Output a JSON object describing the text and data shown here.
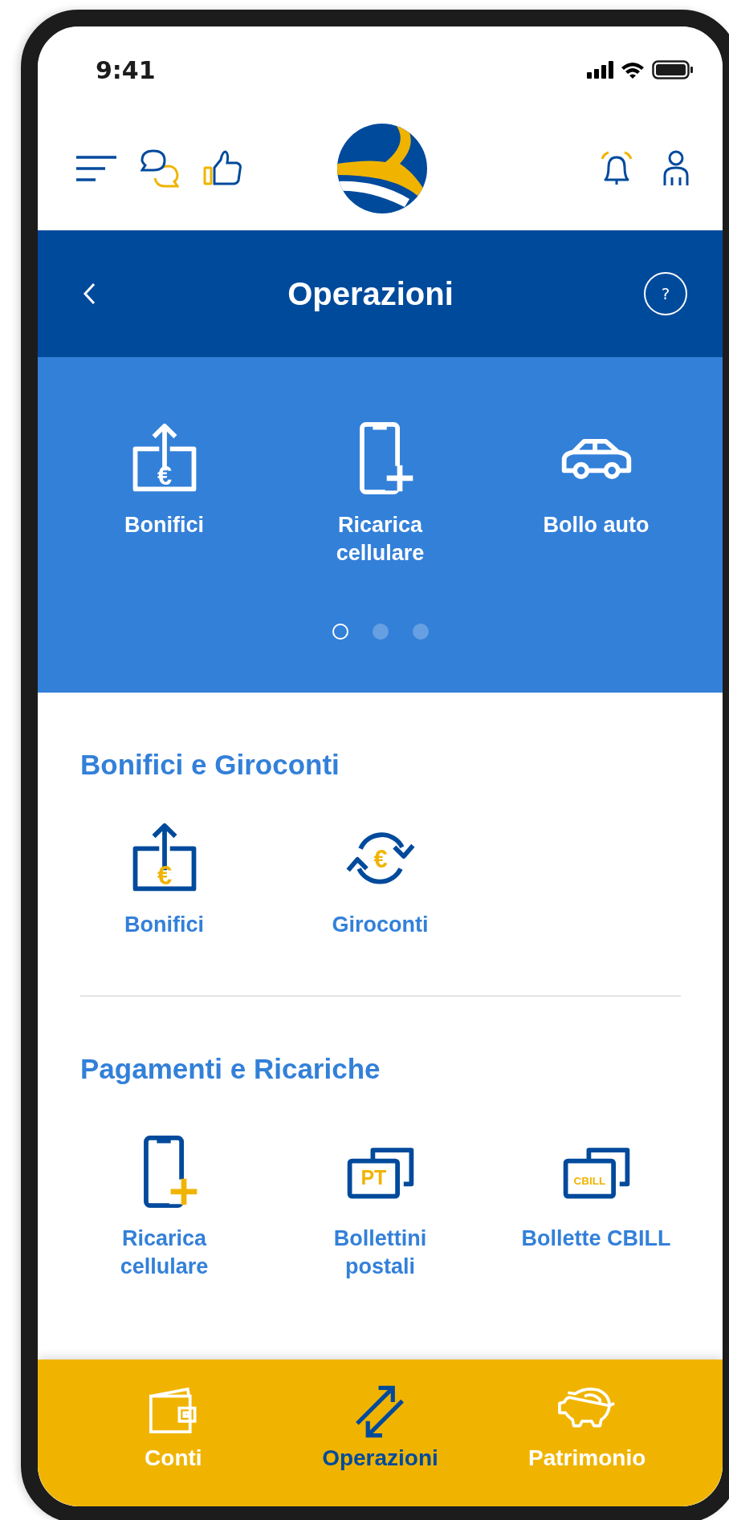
{
  "status_bar": {
    "time": "9:41"
  },
  "title_bar": {
    "title": "Operazioni",
    "help": "?"
  },
  "carousel": {
    "items": [
      {
        "label": "Bonifici",
        "kind": "transfer",
        "symbol": "€"
      },
      {
        "label": "Ricarica cellulare",
        "kind": "phone"
      },
      {
        "label": "Bollo auto",
        "kind": "car"
      }
    ],
    "pages": [
      {
        "selected": true
      },
      {
        "selected": false
      },
      {
        "selected": false
      }
    ]
  },
  "sections": [
    {
      "title": "Bonifici e Giroconti",
      "items": [
        {
          "label": "Bonifici",
          "kind": "transfer",
          "symbol": "€"
        },
        {
          "label": "Giroconti",
          "kind": "exchange",
          "symbol": "€"
        }
      ]
    },
    {
      "title": "Pagamenti e Ricariche",
      "items": [
        {
          "label": "Ricarica cellulare",
          "kind": "phone"
        },
        {
          "label": "Bollettini postali",
          "kind": "bills",
          "symbol": "PT"
        },
        {
          "label": "Bollette CBILL",
          "kind": "bills",
          "symbol": "CBILL"
        }
      ]
    }
  ],
  "bottom_nav": [
    {
      "label": "Conti",
      "kind": "wallet",
      "selected": false
    },
    {
      "label": "Operazioni",
      "kind": "arrows",
      "selected": true
    },
    {
      "label": "Patrimonio",
      "kind": "piggy",
      "selected": false
    }
  ]
}
